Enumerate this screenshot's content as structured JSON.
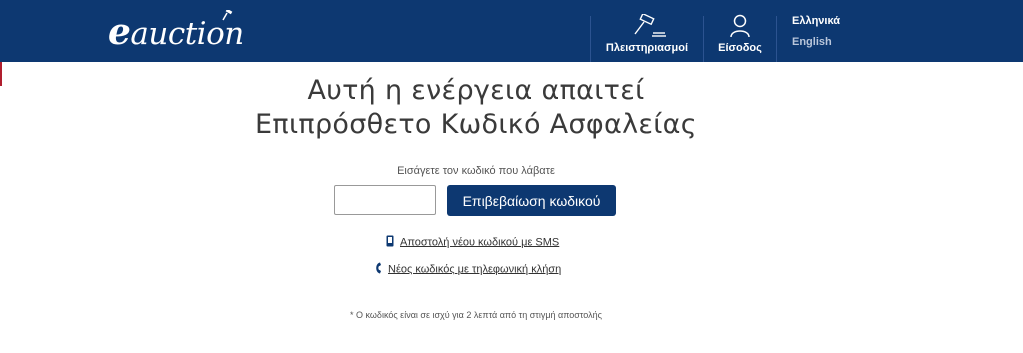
{
  "header": {
    "logo_e": "e",
    "logo_text": "auction",
    "nav": [
      {
        "label": "Πλειστηριασμοί",
        "icon": "gavel-icon"
      },
      {
        "label": "Είσοδος",
        "icon": "user-icon"
      }
    ],
    "languages": {
      "active": "Ελληνικά",
      "other": "English"
    }
  },
  "main": {
    "title_line1": "Αυτή η ενέργεια απαιτεί",
    "title_line2": "Επιπρόσθετο Κωδικό Ασφαλείας",
    "prompt": "Εισάγετε τον κωδικό που λάβατε",
    "code_input_value": "",
    "confirm_button": "Επιβεβαίωση κωδικού",
    "sms_link": "Αποστολή νέου κωδικού με SMS",
    "call_link": "Νέος κωδικός με τηλεφωνική κλήση",
    "footnote": "* Ο κωδικός είναι σε ισχύ για 2 λεπτά από τη στιγμή αποστολής"
  },
  "colors": {
    "brand": "#0d3871",
    "accent": "#b01e2e"
  }
}
